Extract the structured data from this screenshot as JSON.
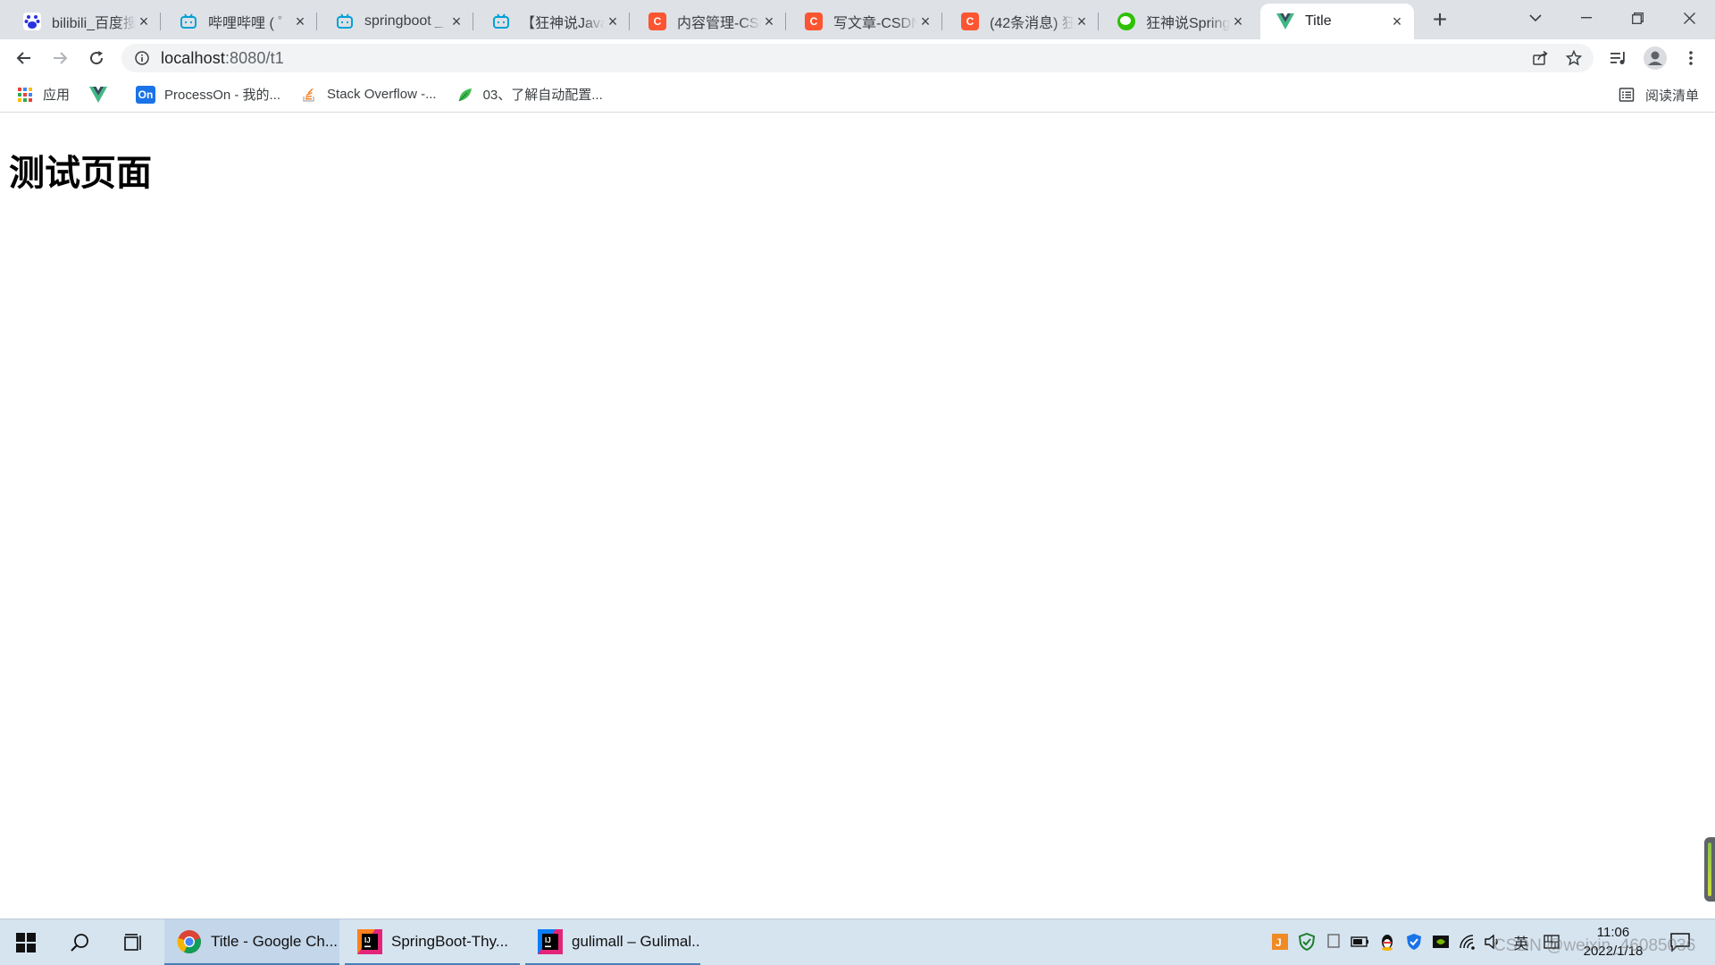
{
  "tabs": [
    {
      "title": "bilibili_百度搜",
      "favicon": "baidu-paw-icon"
    },
    {
      "title": "哔哩哔哩 ( ゜-",
      "favicon": "bilibili-tv-icon"
    },
    {
      "title": "springboot _",
      "favicon": "bilibili-tv-icon"
    },
    {
      "title": "【狂神说Java】",
      "favicon": "bilibili-tv-icon"
    },
    {
      "title": "内容管理-CSD",
      "favicon": "csdn-c-icon"
    },
    {
      "title": "写文章-CSDN",
      "favicon": "csdn-c-icon"
    },
    {
      "title": "(42条消息) 狂",
      "favicon": "csdn-c-icon"
    },
    {
      "title": "狂神说Spring",
      "favicon": "wechat-icon"
    },
    {
      "title": "Title",
      "favicon": "vue-icon",
      "active": true
    }
  ],
  "toolbar": {
    "url_host": "localhost",
    "url_path": ":8080/t1"
  },
  "bookmarks": {
    "apps_label": "应用",
    "items": [
      {
        "label": "",
        "icon": "vue-icon"
      },
      {
        "label": "ProcessOn - 我的...",
        "icon": "processon-icon",
        "badge": "On"
      },
      {
        "label": "Stack Overflow -...",
        "icon": "stackoverflow-icon"
      },
      {
        "label": "03、了解自动配置...",
        "icon": "leaf-icon"
      }
    ],
    "reading_list_label": "阅读清单"
  },
  "page": {
    "heading": "测试页面"
  },
  "taskbar": {
    "apps": [
      {
        "label": "Title - Google Ch...",
        "icon": "chrome-icon",
        "active": true
      },
      {
        "label": "SpringBoot-Thy...",
        "icon": "intellij-icon"
      },
      {
        "label": "gulimall – Gulimal...",
        "icon": "intellij-icon"
      }
    ],
    "ime_label": "英",
    "time": "11:06",
    "date": "2022/1/18"
  },
  "watermark": "CSDN @weixin_46085036",
  "colors": {
    "csdn": "#fc5531",
    "bilibili": "#00a1d6",
    "vue": "#41b883",
    "taskbar": "#d6e4f0"
  }
}
